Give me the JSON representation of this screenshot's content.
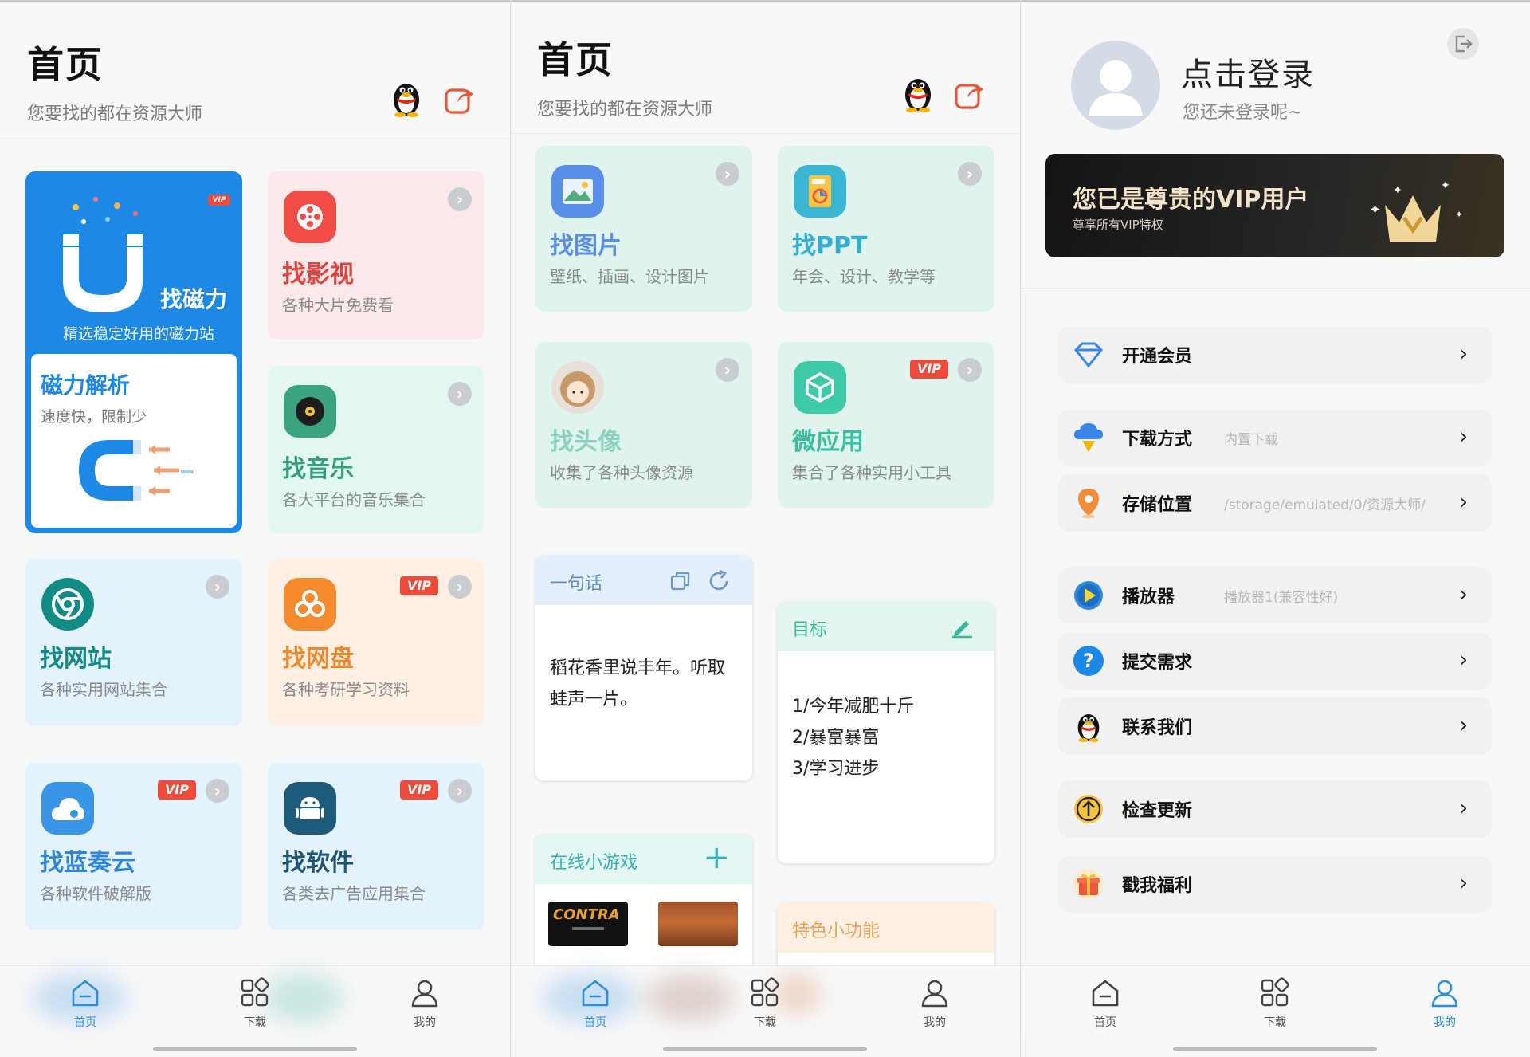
{
  "home1": {
    "title": "首页",
    "subtitle": "您要找的都在资源大师",
    "cards": [
      {
        "title": "找磁力",
        "sub": "精选稳定好用的磁力站",
        "badge": "VIP"
      },
      {
        "title": "磁力解析",
        "sub": "速度快，限制少"
      },
      {
        "title": "找影视",
        "sub": "各种大片免费看"
      },
      {
        "title": "找音乐",
        "sub": "各大平台的音乐集合"
      },
      {
        "title": "找网站",
        "sub": "各种实用网站集合"
      },
      {
        "title": "找网盘",
        "sub": "各种考研学习资料",
        "badge": "VIP"
      },
      {
        "title": "找蓝奏云",
        "sub": "各种软件破解版",
        "badge": "VIP"
      },
      {
        "title": "找软件",
        "sub": "各类去广告应用集合",
        "badge": "VIP"
      }
    ]
  },
  "home2": {
    "title": "首页",
    "subtitle": "您要找的都在资源大师",
    "cards": [
      {
        "title": "找图片",
        "sub": "壁纸、插画、设计图片",
        "icon_text": "图"
      },
      {
        "title": "找PPT",
        "sub": "年会、设计、教学等",
        "icon_text": "PPT"
      },
      {
        "title": "找头像",
        "sub": "收集了各种头像资源"
      },
      {
        "title": "微应用",
        "sub": "集合了各种实用小工具",
        "badge": "VIP"
      }
    ],
    "quote": {
      "label": "一句话",
      "text": "稻花香里说丰年。听取蛙声一片。"
    },
    "goals": {
      "label": "目标",
      "items": [
        "1/今年减肥十斤",
        "2/暴富暴富",
        "3/学习进步"
      ]
    },
    "games": {
      "label": "在线小游戏",
      "g1": "CONTRA"
    },
    "features": {
      "label": "特色小功能"
    }
  },
  "mine": {
    "login": "点击登录",
    "login_sub": "您还未登录呢~",
    "vip_title": "您已是尊贵的VIP用户",
    "vip_sub": "尊享所有VIP特权",
    "menu": [
      {
        "label": "开通会员",
        "value": "",
        "icon": "diamond-icon"
      },
      {
        "label": "下载方式",
        "value": "内置下载",
        "icon": "download-icon"
      },
      {
        "label": "存储位置",
        "value": "/storage/emulated/0/资源大师/",
        "icon": "location-pin-icon"
      },
      {
        "label": "播放器",
        "value": "播放器1(兼容性好)",
        "icon": "play-icon"
      },
      {
        "label": "提交需求",
        "value": "",
        "icon": "question-icon"
      },
      {
        "label": "联系我们",
        "value": "",
        "icon": "qq-penguin-icon"
      },
      {
        "label": "检查更新",
        "value": "",
        "icon": "update-arrow-icon"
      },
      {
        "label": "戳我福利",
        "value": "",
        "icon": "gift-icon"
      }
    ]
  },
  "nav": {
    "home": "首页",
    "download": "下载",
    "mine": "我的"
  },
  "colors": {
    "accent": "#2c8ddb",
    "vip_red": "#ee4b3d",
    "magnet_blue": "#1e88e5"
  }
}
